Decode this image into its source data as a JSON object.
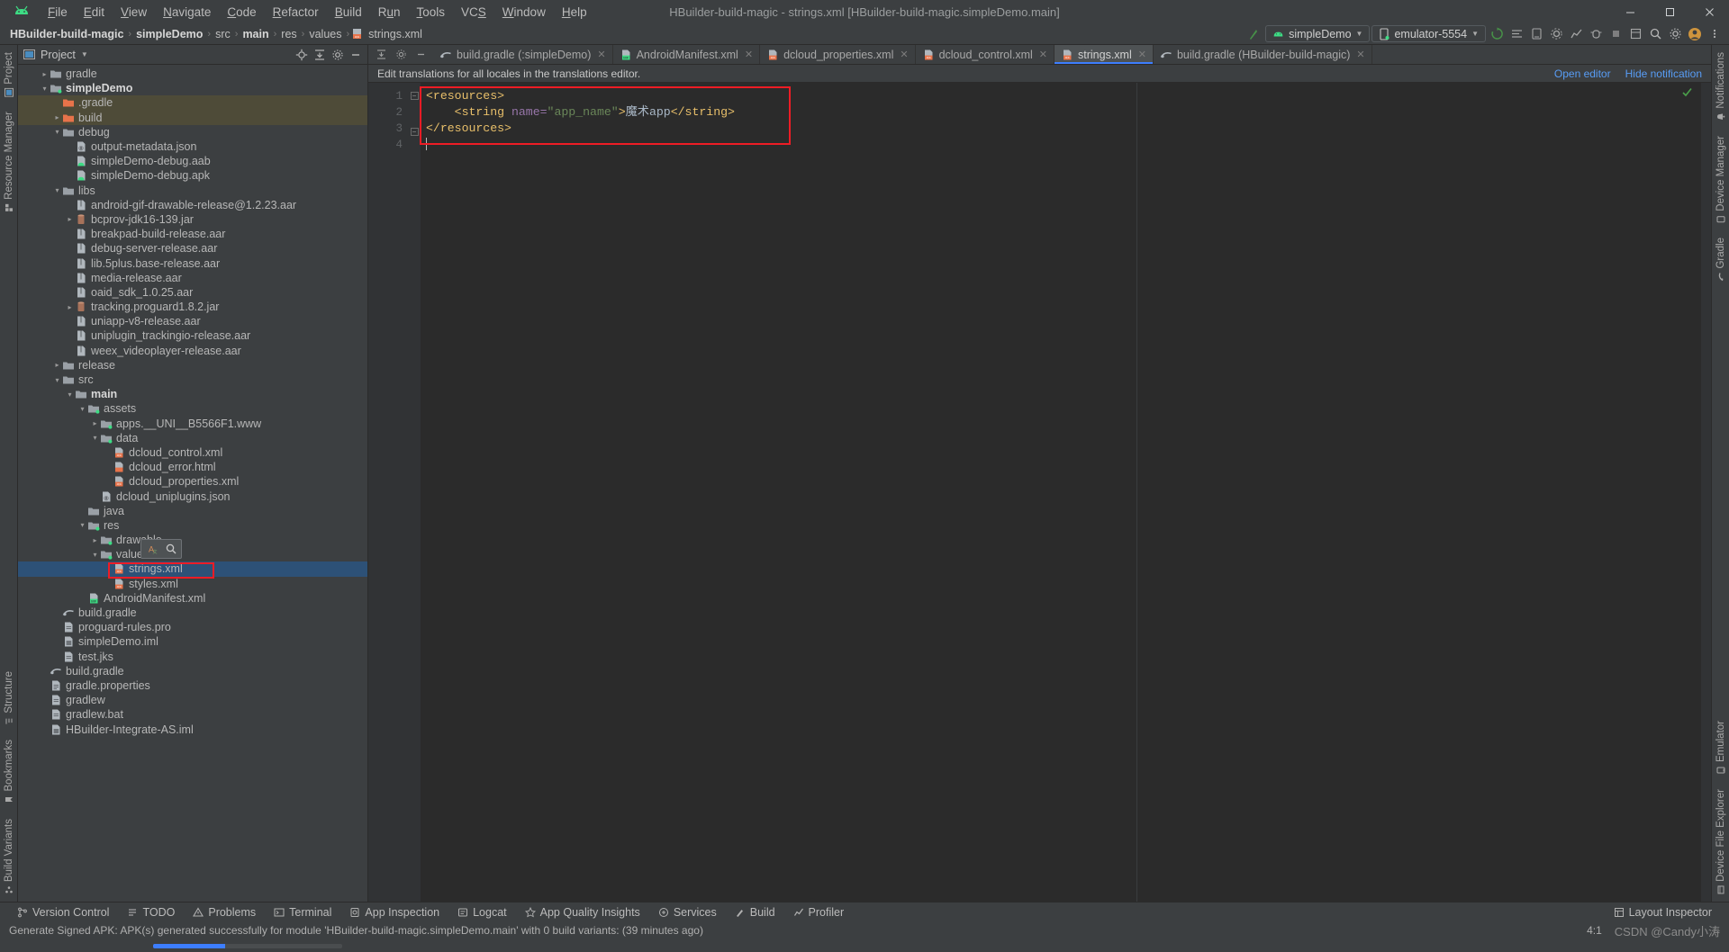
{
  "window": {
    "title": "HBuilder-build-magic - strings.xml [HBuilder-build-magic.simpleDemo.main]",
    "minimize": "–",
    "maximize": "☐",
    "close": "✕"
  },
  "menubar": {
    "logo_name": "android-studio-logo",
    "items": [
      {
        "label": "File",
        "mnemonic": "F"
      },
      {
        "label": "Edit",
        "mnemonic": "E"
      },
      {
        "label": "View",
        "mnemonic": "V"
      },
      {
        "label": "Navigate",
        "mnemonic": "N"
      },
      {
        "label": "Code",
        "mnemonic": "C"
      },
      {
        "label": "Refactor",
        "mnemonic": "R"
      },
      {
        "label": "Build",
        "mnemonic": "B"
      },
      {
        "label": "Run",
        "mnemonic": "n"
      },
      {
        "label": "Tools",
        "mnemonic": "T"
      },
      {
        "label": "VCS",
        "mnemonic": "S"
      },
      {
        "label": "Window",
        "mnemonic": "W"
      },
      {
        "label": "Help",
        "mnemonic": "H"
      }
    ]
  },
  "navbar": {
    "breadcrumbs": [
      {
        "label": "HBuilder-build-magic",
        "bold": true
      },
      {
        "label": "simpleDemo",
        "bold": true
      },
      {
        "label": "src",
        "bold": false
      },
      {
        "label": "main",
        "bold": true
      },
      {
        "label": "res",
        "bold": false
      },
      {
        "label": "values",
        "bold": false
      },
      {
        "label": "strings.xml",
        "bold": false,
        "icon": "xml-file-icon"
      }
    ],
    "separator": "›",
    "run_config": "simpleDemo",
    "device": "emulator-5554",
    "dropdown_caret": "▼",
    "actions": [
      "make-project-icon",
      "sync-gradle-icon",
      "avd-manager-icon",
      "sdk-manager-icon",
      "run-icon",
      "debug-icon",
      "profile-icon",
      "attach-debugger-icon",
      "stop-icon",
      "search-everywhere-icon",
      "settings-icon",
      "account-icon"
    ]
  },
  "left_strip": {
    "top": [
      {
        "label": "Project",
        "icon": "project-icon"
      },
      {
        "label": "Resource Manager",
        "icon": "resource-manager-icon"
      }
    ],
    "bottom": [
      {
        "label": "Structure",
        "icon": "structure-icon"
      },
      {
        "label": "Bookmarks",
        "icon": "bookmark-icon"
      },
      {
        "label": "Build Variants",
        "icon": "build-variants-icon"
      }
    ]
  },
  "right_strip": {
    "items": [
      {
        "label": "Notifications",
        "icon": "bell-icon"
      },
      {
        "label": "Device Manager",
        "icon": "device-manager-icon"
      },
      {
        "label": "Gradle",
        "icon": "gradle-icon"
      },
      {
        "label": "Emulator",
        "icon": "emulator-icon"
      },
      {
        "label": "Device File Explorer",
        "icon": "device-file-explorer-icon"
      }
    ]
  },
  "project_panel": {
    "title": "Project",
    "dropdown_caret": "▼",
    "header_icons": [
      "target-icon",
      "collapse-all-icon",
      "settings-icon",
      "hide-icon"
    ],
    "tree": [
      {
        "label": "gradle",
        "indent": 1,
        "arrow": "›",
        "icon": "folder-gray",
        "state": "none"
      },
      {
        "label": "simpleDemo",
        "indent": 1,
        "arrow": "⌄",
        "icon": "folder-module",
        "bold": true,
        "state": "none"
      },
      {
        "label": ".gradle",
        "indent": 2,
        "arrow": "",
        "icon": "folder-orange",
        "state": "olive"
      },
      {
        "label": "build",
        "indent": 2,
        "arrow": "›",
        "icon": "folder-orange",
        "state": "olive"
      },
      {
        "label": "debug",
        "indent": 2,
        "arrow": "⌄",
        "icon": "folder-gray",
        "state": "none"
      },
      {
        "label": "output-metadata.json",
        "indent": 3,
        "arrow": "",
        "icon": "json-file",
        "state": "none"
      },
      {
        "label": "simpleDemo-debug.aab",
        "indent": 3,
        "arrow": "",
        "icon": "android-file",
        "state": "none"
      },
      {
        "label": "simpleDemo-debug.apk",
        "indent": 3,
        "arrow": "",
        "icon": "android-file",
        "state": "none"
      },
      {
        "label": "libs",
        "indent": 2,
        "arrow": "⌄",
        "icon": "folder-gray",
        "state": "none"
      },
      {
        "label": "android-gif-drawable-release@1.2.23.aar",
        "indent": 3,
        "arrow": "",
        "icon": "archive-file",
        "state": "none"
      },
      {
        "label": "bcprov-jdk16-139.jar",
        "indent": 3,
        "arrow": "›",
        "icon": "jar-file",
        "state": "none"
      },
      {
        "label": "breakpad-build-release.aar",
        "indent": 3,
        "arrow": "",
        "icon": "archive-file",
        "state": "none"
      },
      {
        "label": "debug-server-release.aar",
        "indent": 3,
        "arrow": "",
        "icon": "archive-file",
        "state": "none"
      },
      {
        "label": "lib.5plus.base-release.aar",
        "indent": 3,
        "arrow": "",
        "icon": "archive-file",
        "state": "none"
      },
      {
        "label": "media-release.aar",
        "indent": 3,
        "arrow": "",
        "icon": "archive-file",
        "state": "none"
      },
      {
        "label": "oaid_sdk_1.0.25.aar",
        "indent": 3,
        "arrow": "",
        "icon": "archive-file",
        "state": "none"
      },
      {
        "label": "tracking.proguard1.8.2.jar",
        "indent": 3,
        "arrow": "›",
        "icon": "jar-file",
        "state": "none"
      },
      {
        "label": "uniapp-v8-release.aar",
        "indent": 3,
        "arrow": "",
        "icon": "archive-file",
        "state": "none"
      },
      {
        "label": "uniplugin_trackingio-release.aar",
        "indent": 3,
        "arrow": "",
        "icon": "archive-file",
        "state": "none"
      },
      {
        "label": "weex_videoplayer-release.aar",
        "indent": 3,
        "arrow": "",
        "icon": "archive-file",
        "state": "none"
      },
      {
        "label": "release",
        "indent": 2,
        "arrow": "›",
        "icon": "folder-gray",
        "state": "none"
      },
      {
        "label": "src",
        "indent": 2,
        "arrow": "⌄",
        "icon": "folder-gray",
        "state": "none"
      },
      {
        "label": "main",
        "indent": 3,
        "arrow": "⌄",
        "icon": "folder-gray",
        "bold": true,
        "state": "none"
      },
      {
        "label": "assets",
        "indent": 4,
        "arrow": "⌄",
        "icon": "folder-module",
        "state": "none"
      },
      {
        "label": "apps.__UNI__B5566F1.www",
        "indent": 5,
        "arrow": "›",
        "icon": "folder-module",
        "state": "none"
      },
      {
        "label": "data",
        "indent": 5,
        "arrow": "⌄",
        "icon": "folder-module",
        "state": "none"
      },
      {
        "label": "dcloud_control.xml",
        "indent": 6,
        "arrow": "",
        "icon": "xml-file",
        "state": "none"
      },
      {
        "label": "dcloud_error.html",
        "indent": 6,
        "arrow": "",
        "icon": "html-file",
        "state": "none"
      },
      {
        "label": "dcloud_properties.xml",
        "indent": 6,
        "arrow": "",
        "icon": "xml-file",
        "state": "none"
      },
      {
        "label": "dcloud_uniplugins.json",
        "indent": 5,
        "arrow": "",
        "icon": "json-file",
        "state": "none"
      },
      {
        "label": "java",
        "indent": 4,
        "arrow": "",
        "icon": "folder-gray",
        "state": "none"
      },
      {
        "label": "res",
        "indent": 4,
        "arrow": "⌄",
        "icon": "folder-module",
        "state": "none"
      },
      {
        "label": "drawable",
        "indent": 5,
        "arrow": "›",
        "icon": "folder-module",
        "state": "none"
      },
      {
        "label": "values",
        "indent": 5,
        "arrow": "⌄",
        "icon": "folder-module",
        "state": "none"
      },
      {
        "label": "strings.xml",
        "indent": 6,
        "arrow": "",
        "icon": "xml-file",
        "state": "blue"
      },
      {
        "label": "styles.xml",
        "indent": 6,
        "arrow": "",
        "icon": "xml-file",
        "state": "none"
      },
      {
        "label": "AndroidManifest.xml",
        "indent": 4,
        "arrow": "",
        "icon": "manifest-file",
        "state": "none"
      },
      {
        "label": "build.gradle",
        "indent": 2,
        "arrow": "",
        "icon": "gradle-file",
        "state": "none"
      },
      {
        "label": "proguard-rules.pro",
        "indent": 2,
        "arrow": "",
        "icon": "text-file",
        "state": "none"
      },
      {
        "label": "simpleDemo.iml",
        "indent": 2,
        "arrow": "",
        "icon": "iml-file",
        "state": "none"
      },
      {
        "label": "test.jks",
        "indent": 2,
        "arrow": "",
        "icon": "text-file",
        "state": "none"
      },
      {
        "label": "build.gradle",
        "indent": 1,
        "arrow": "",
        "icon": "gradle-file",
        "state": "none"
      },
      {
        "label": "gradle.properties",
        "indent": 1,
        "arrow": "",
        "icon": "props-file",
        "state": "none"
      },
      {
        "label": "gradlew",
        "indent": 1,
        "arrow": "",
        "icon": "text-file",
        "state": "none"
      },
      {
        "label": "gradlew.bat",
        "indent": 1,
        "arrow": "",
        "icon": "text-file",
        "state": "none"
      },
      {
        "label": "HBuilder-Integrate-AS.iml",
        "indent": 1,
        "arrow": "",
        "icon": "iml-file",
        "state": "none"
      }
    ]
  },
  "editor": {
    "toolbar_icons": [
      "expand-collapse-icon",
      "settings-gear-icon",
      "minimize-icon"
    ],
    "tabs": [
      {
        "label": "build.gradle (:simpleDemo)",
        "icon": "gradle-file-icon",
        "active": false,
        "closable": true
      },
      {
        "label": "AndroidManifest.xml",
        "icon": "manifest-file-icon",
        "active": false,
        "closable": true
      },
      {
        "label": "dcloud_properties.xml",
        "icon": "xml-file-icon",
        "active": false,
        "closable": true
      },
      {
        "label": "dcloud_control.xml",
        "icon": "xml-file-icon",
        "active": false,
        "closable": true
      },
      {
        "label": "strings.xml",
        "icon": "xml-file-icon",
        "active": true,
        "closable": true
      },
      {
        "label": "build.gradle (HBuilder-build-magic)",
        "icon": "gradle-file-icon",
        "active": false,
        "closable": true
      }
    ],
    "close_glyph": "✕",
    "notification": {
      "message": "Edit translations for all locales in the translations editor.",
      "open_editor": "Open editor",
      "hide_notification": "Hide notification"
    },
    "line_numbers": [
      "1",
      "2",
      "3",
      "4"
    ],
    "code_lines": [
      {
        "n": "1",
        "fold": "−",
        "segments": [
          {
            "t": "<resources>",
            "c": "tag"
          }
        ]
      },
      {
        "n": "2",
        "fold": "",
        "segments": [
          {
            "t": "    <string ",
            "c": "tag"
          },
          {
            "t": "name=",
            "c": "attr"
          },
          {
            "t": "\"app_name\"",
            "c": "val"
          },
          {
            "t": ">",
            "c": "tag"
          },
          {
            "t": "魔术app",
            "c": "txt"
          },
          {
            "t": "</string>",
            "c": "tag"
          }
        ]
      },
      {
        "n": "3",
        "fold": "−",
        "segments": [
          {
            "t": "</resources>",
            "c": "tag"
          }
        ]
      },
      {
        "n": "4",
        "fold": "",
        "segments": []
      }
    ],
    "inspection_status": "check-ok-icon",
    "annotation_popup_icons": [
      "translate-icon",
      "search-icon"
    ]
  },
  "bottom_tools": [
    {
      "label": "Version Control",
      "icon": "branch-icon"
    },
    {
      "label": "TODO",
      "icon": "todo-icon"
    },
    {
      "label": "Problems",
      "icon": "problems-icon"
    },
    {
      "label": "Terminal",
      "icon": "terminal-icon"
    },
    {
      "label": "App Inspection",
      "icon": "app-inspection-icon"
    },
    {
      "label": "Logcat",
      "icon": "logcat-icon"
    },
    {
      "label": "App Quality Insights",
      "icon": "insights-icon"
    },
    {
      "label": "Services",
      "icon": "services-icon"
    },
    {
      "label": "Build",
      "icon": "build-icon"
    },
    {
      "label": "Profiler",
      "icon": "profiler-icon"
    }
  ],
  "bottom_right": [
    {
      "label": "Layout Inspector",
      "icon": "layout-inspector-icon"
    }
  ],
  "statusbar": {
    "message": "Generate Signed APK: APK(s) generated successfully for module 'HBuilder-build-magic.simpleDemo.main' with 0 build variants: (39 minutes ago)",
    "caret_position": "4:1",
    "watermark": "CSDN @Candy小涛",
    "extra": "✓"
  },
  "colors": {
    "accent_blue": "#3d7eff",
    "annotation_red": "#ee1c25",
    "selection_blue": "#2d5177",
    "selection_olive": "#4e4b38",
    "folder_orange": "#e8734a",
    "android_green": "#3ddc84",
    "link_blue": "#589df6"
  }
}
